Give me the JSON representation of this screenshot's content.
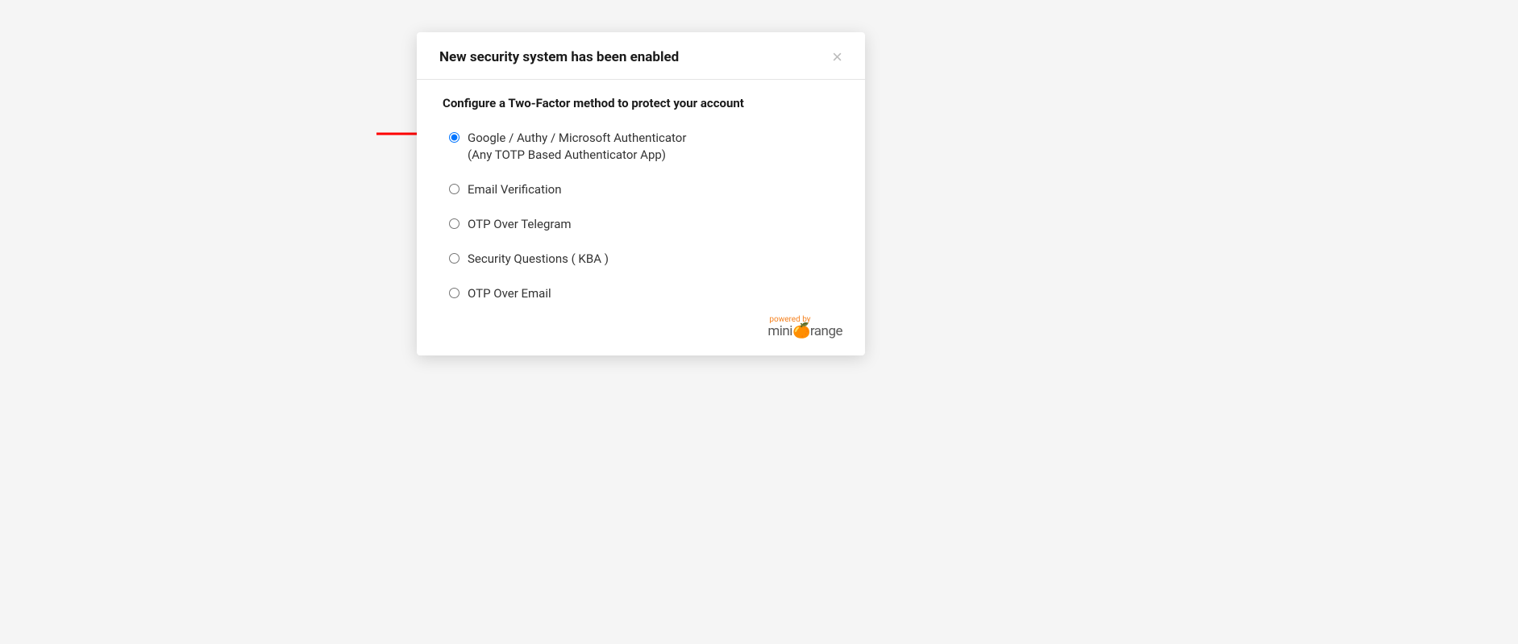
{
  "modal": {
    "title": "New security system has been enabled",
    "subtitle": "Configure a Two-Factor method to protect your account",
    "options": [
      {
        "label": "Google / Authy / Microsoft Authenticator",
        "sublabel": "(Any TOTP Based Authenticator App)",
        "selected": true
      },
      {
        "label": "Email Verification",
        "sublabel": "",
        "selected": false
      },
      {
        "label": "OTP Over Telegram",
        "sublabel": "",
        "selected": false
      },
      {
        "label": "Security Questions ( KBA )",
        "sublabel": "",
        "selected": false
      },
      {
        "label": "OTP Over Email",
        "sublabel": "",
        "selected": false
      }
    ],
    "footer": {
      "powered_by": "powered by",
      "brand_mini": "mini",
      "brand_orange": "range"
    }
  }
}
